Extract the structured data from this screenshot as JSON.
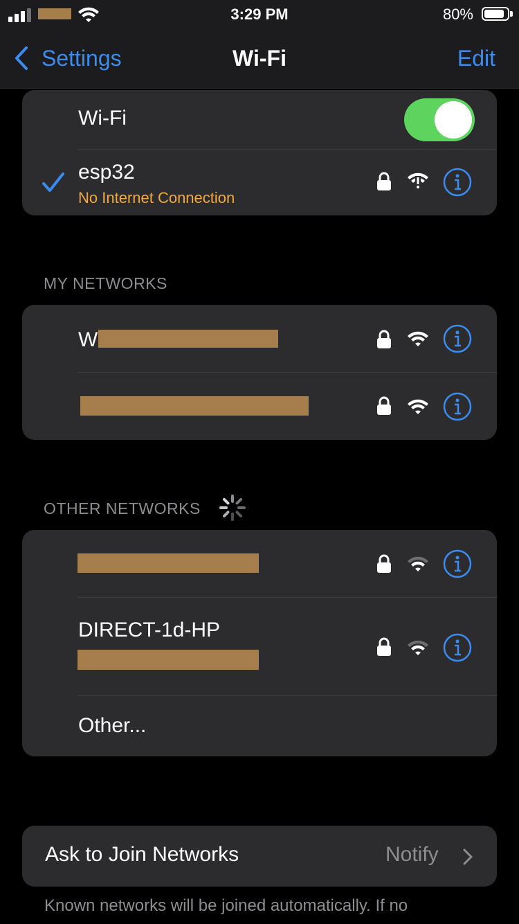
{
  "status_bar": {
    "time": "3:29 PM",
    "battery_percent": "80%",
    "battery_level": 0.8,
    "signal_bars": 3,
    "wifi_status_icon": "wifi-icon"
  },
  "nav": {
    "back_label": "Settings",
    "title": "Wi-Fi",
    "edit_label": "Edit"
  },
  "wifi_card": {
    "toggle_label": "Wi-Fi",
    "toggle_on": true,
    "connected_network": {
      "name": "esp32",
      "status": "No Internet Connection",
      "status_color": "#f2a93b"
    }
  },
  "my_networks": {
    "header": "MY NETWORKS",
    "items": [
      {
        "name": "W",
        "secured": true
      },
      {
        "name": "",
        "secured": true
      }
    ]
  },
  "other_networks": {
    "header": "OTHER NETWORKS",
    "items": [
      {
        "name": "",
        "secured": true
      },
      {
        "name": "DIRECT-1d-HP",
        "secured": true
      }
    ],
    "other_label": "Other..."
  },
  "ask_to_join": {
    "label": "Ask to Join Networks",
    "value": "Notify"
  },
  "footer_text": "Known networks will be joined automatically. If no",
  "colors": {
    "accent": "#3b8cf0",
    "toggle_on": "#5cd45d",
    "warning": "#f2a93b",
    "background": "#000000",
    "card": "#2c2c2e"
  }
}
